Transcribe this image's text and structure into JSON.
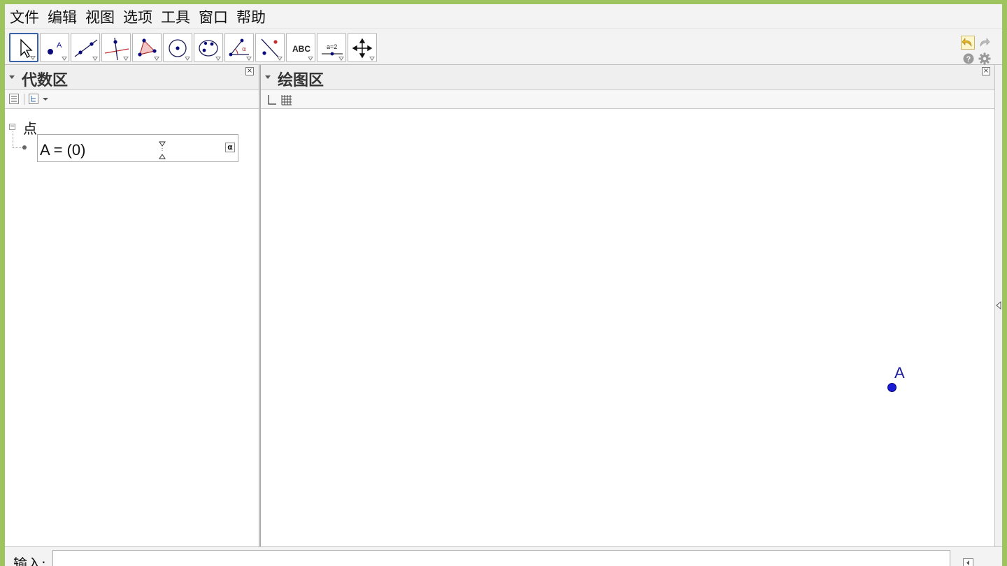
{
  "menu": [
    "文件",
    "编辑",
    "视图",
    "选项",
    "工具",
    "窗口",
    "帮助"
  ],
  "toolbar": {
    "tools": [
      {
        "name": "move-tool",
        "icon": "arrow-cursor-icon",
        "active": true
      },
      {
        "name": "point-tool",
        "icon": "point-icon"
      },
      {
        "name": "line-tool",
        "icon": "line-icon"
      },
      {
        "name": "perpendicular-line-tool",
        "icon": "perpendicular-icon"
      },
      {
        "name": "polygon-tool",
        "icon": "polygon-icon"
      },
      {
        "name": "circle-tool",
        "icon": "circle-center-icon"
      },
      {
        "name": "conic-tool",
        "icon": "ellipse-icon"
      },
      {
        "name": "angle-tool",
        "icon": "angle-icon"
      },
      {
        "name": "reflect-tool",
        "icon": "reflect-line-icon"
      },
      {
        "name": "text-tool",
        "icon": "text-abc-icon",
        "text": "ABC"
      },
      {
        "name": "slider-tool",
        "icon": "slider-icon",
        "text": "a=2"
      },
      {
        "name": "move-graphics-tool",
        "icon": "move-view-icon"
      }
    ]
  },
  "algebra": {
    "title": "代数区",
    "group_label": "点",
    "entries": [
      {
        "text": "A = (0)"
      }
    ],
    "alpha_button": "α"
  },
  "graphics": {
    "title": "绘图区",
    "points": [
      {
        "label": "A",
        "color": "#1a1ad6"
      }
    ]
  },
  "input": {
    "label": "输入:",
    "value": ""
  },
  "colors": {
    "window_frame": "#9dc45f",
    "active_tool_border": "#3b62a8",
    "point_color": "#1a1ad6"
  }
}
